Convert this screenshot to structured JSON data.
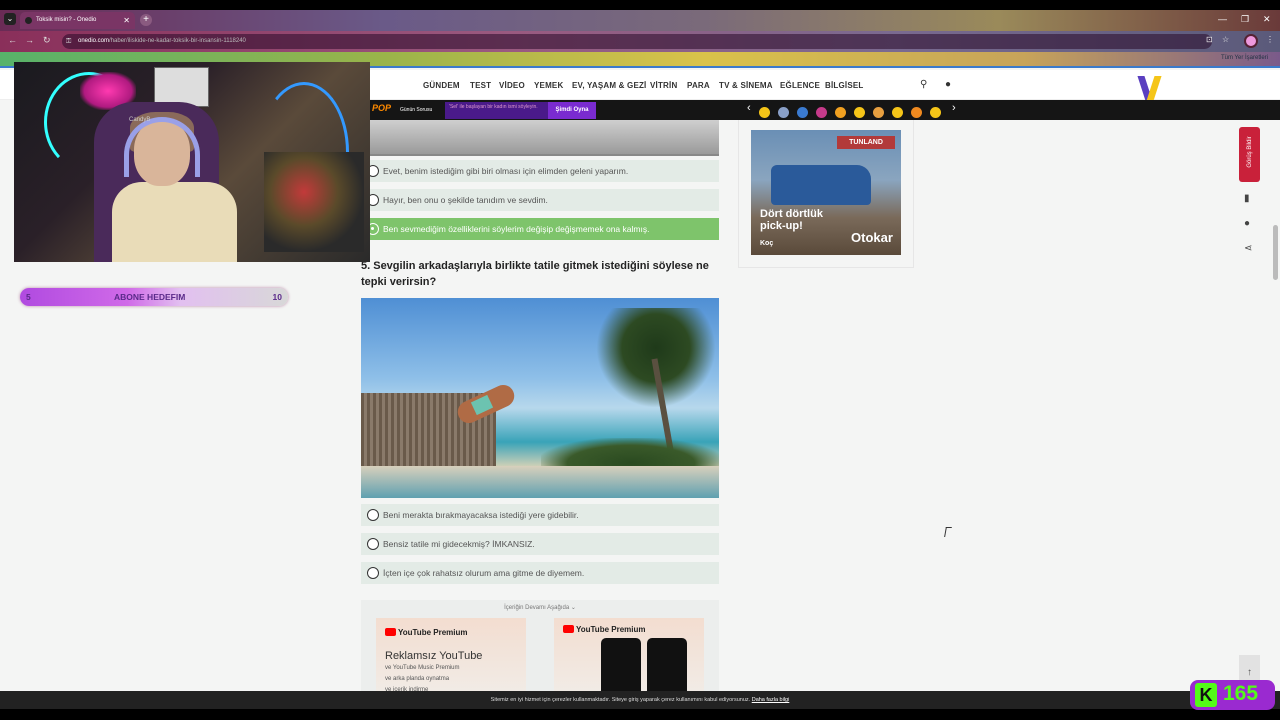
{
  "browser": {
    "tab_title": "Toksik misin? - Onedio",
    "url_host": "onedio.com",
    "url_path": "/haber/iliskide-ne-kadar-toksik-bir-insansin-1118240",
    "bookmarks_right": "Tüm Yer İşaretleri"
  },
  "nav": {
    "items": [
      "GÜNDEM",
      "TEST",
      "VİDEO",
      "YEMEK",
      "EV, YAŞAM & GEZİ",
      "VİTRİN",
      "PARA",
      "TV & SİNEMA",
      "EĞLENCE",
      "BİLGİSEL"
    ]
  },
  "strip": {
    "pop": "POP",
    "gunun": "Günün Sorusu",
    "question": "'Sel' ile başlayan bir kadın ismi söyleyin.",
    "play": "Şimdi Oyna"
  },
  "emoji_colors": [
    "#f5c518",
    "#8aa0c8",
    "#3a7ad0",
    "#c63a8a",
    "#f0a020",
    "#f5c518",
    "#e8a040",
    "#f5c518",
    "#f08a20",
    "#f5c518"
  ],
  "prev_options": [
    {
      "label": "Evet, benim istediğim gibi biri olması için elimden geleni yaparım.",
      "selected": false
    },
    {
      "label": "Hayır, ben onu o şekilde tanıdım ve sevdim.",
      "selected": false
    },
    {
      "label": "Ben sevmediğim özelliklerini söylerim değişip değişmemek ona kalmış.",
      "selected": true
    }
  ],
  "question5": "5. Sevgilin arkadaşlarıyla birlikte tatile gitmek istediğini söylese ne tepki verirsin?",
  "options5": [
    {
      "label": "Beni merakta bırakmayacaksa istediği yere gidebilir."
    },
    {
      "label": "Bensiz tatile mi gidecekmiş? İMKANSIZ."
    },
    {
      "label": "İçten içe çok rahatsız olurum ama gitme de diyemem."
    }
  ],
  "ad": {
    "more_label": "İçeriğin Devamı Aşağıda ⌄",
    "yt_brand": "YouTube Premium",
    "yt_title": "Reklamsız YouTube",
    "yt_lines": [
      "ve YouTube Music Premium",
      "ve arka planda oynatma",
      "ve içerik indirme"
    ]
  },
  "side_ad": {
    "tunland": "TUNLAND",
    "headline": "Dört dörtlük pick-up!",
    "brand": "Otokar",
    "koc": "Koç"
  },
  "feedback": "Görüş Bildir",
  "cookie": {
    "text": "Sitemiz en iyi hizmet için çerezler kullanmaktadır. Siteye giriş yaparak çerez kullanımını kabul ediyorsunuz.",
    "link": "Daha fazla bilgi"
  },
  "stream": {
    "cam_name": "CandyB",
    "goal_current": "5",
    "goal_label": "ABONE HEDEFIM",
    "goal_target": "10",
    "viewers": "165",
    "kick_letter": "K"
  }
}
